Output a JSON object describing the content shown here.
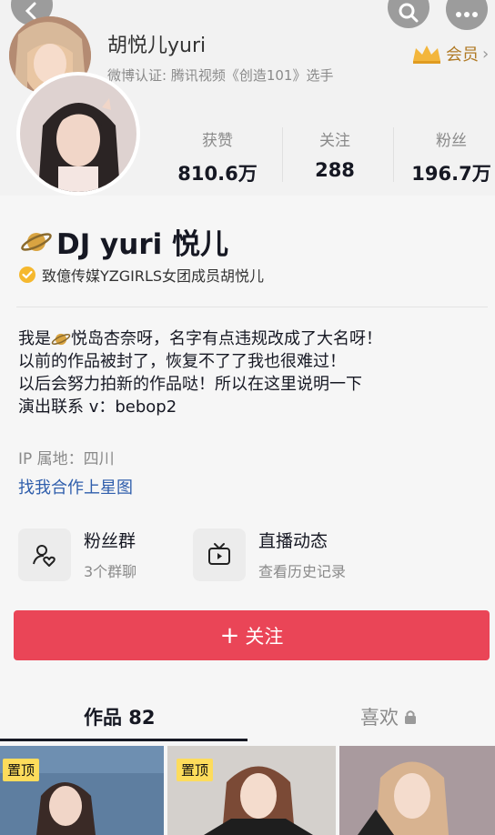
{
  "header": {
    "mini_name": "胡悦儿yuri",
    "mini_subtitle": "微博认证: 腾讯视频《创造101》选手",
    "vip_label": "会员",
    "vip_chevron": "›"
  },
  "stats": [
    {
      "label": "获赞",
      "value": "810.6万"
    },
    {
      "label": "关注",
      "value": "288"
    },
    {
      "label": "粉丝",
      "value": "196.7万"
    }
  ],
  "profile": {
    "name": "DJ yuri 悦儿",
    "verification": "致億传媒YZGIRLS女团成员胡悦儿",
    "bio_lines": [
      {
        "before": "我是 ",
        "after": " 悦岛杏奈呀，名字有点违规改成了大名呀！"
      },
      "以前的作品被封了，恢复不了了我也很难过！",
      "以后会努力拍新的作品哒！所以在这里说明一下",
      "演出联系 v：bebop2"
    ],
    "ip": "IP 属地：四川",
    "link": "找我合作上星图"
  },
  "features": [
    {
      "title": "粉丝群",
      "subtitle": "3个群聊"
    },
    {
      "title": "直播动态",
      "subtitle": "查看历史记录"
    }
  ],
  "follow_button": {
    "plus": "+",
    "label": "关注"
  },
  "tabs": [
    {
      "label": "作品 82",
      "active": true
    },
    {
      "label": "喜欢",
      "active": false
    }
  ],
  "thumbnails": [
    {
      "pin": "置顶"
    },
    {
      "pin": "置顶"
    },
    {
      "pin": ""
    }
  ],
  "icons": [
    "back-icon",
    "search-icon",
    "more-icon",
    "crown-icon",
    "planet-icon",
    "verified-icon",
    "fan-group-icon",
    "live-tv-icon",
    "lock-icon"
  ]
}
